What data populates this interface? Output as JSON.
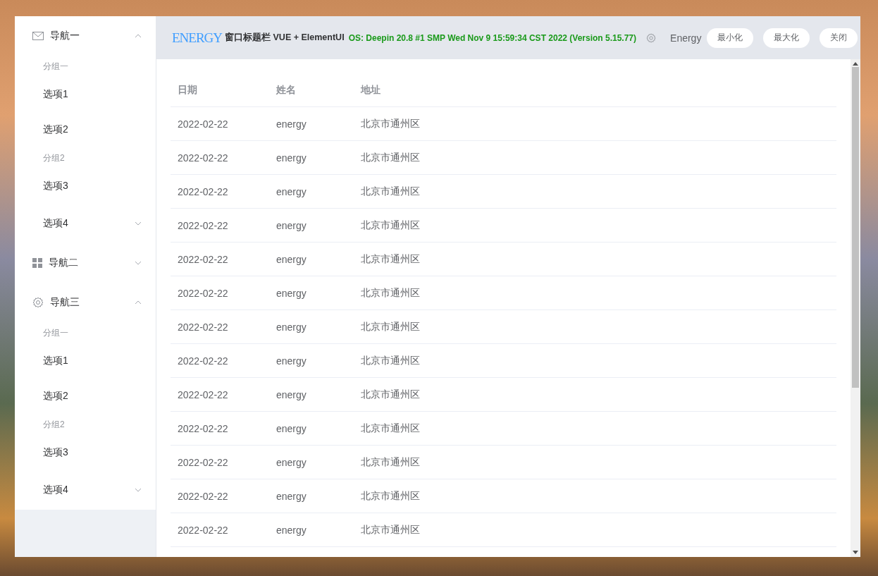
{
  "window": {
    "logo": "ENERGY",
    "title": "窗口标题栏 VUE + ElementUI",
    "os_info": "OS: Deepin 20.8 #1 SMP Wed Nov 9 15:59:34 CST 2022 (Version 5.15.77)",
    "user": "Energy",
    "buttons": [
      "最小化",
      "最大化",
      "关闭"
    ]
  },
  "sidebar": {
    "menus": [
      {
        "title": "导航一",
        "expanded": true,
        "groups": [
          {
            "title": "分组一",
            "items": [
              "选项1",
              "选项2"
            ]
          },
          {
            "title": "分组2",
            "items": [
              "选项3"
            ]
          }
        ],
        "submenus": [
          {
            "title": "选项4",
            "expanded": false
          }
        ]
      },
      {
        "title": "导航二",
        "expanded": false
      },
      {
        "title": "导航三",
        "expanded": true,
        "groups": [
          {
            "title": "分组一",
            "items": [
              "选项1",
              "选项2"
            ]
          },
          {
            "title": "分组2",
            "items": [
              "选项3"
            ]
          }
        ],
        "submenus": [
          {
            "title": "选项4",
            "expanded": false
          }
        ]
      }
    ]
  },
  "table": {
    "columns": [
      "日期",
      "姓名",
      "地址"
    ],
    "rows": [
      [
        "2022-02-22",
        "energy",
        "北京市通州区"
      ],
      [
        "2022-02-22",
        "energy",
        "北京市通州区"
      ],
      [
        "2022-02-22",
        "energy",
        "北京市通州区"
      ],
      [
        "2022-02-22",
        "energy",
        "北京市通州区"
      ],
      [
        "2022-02-22",
        "energy",
        "北京市通州区"
      ],
      [
        "2022-02-22",
        "energy",
        "北京市通州区"
      ],
      [
        "2022-02-22",
        "energy",
        "北京市通州区"
      ],
      [
        "2022-02-22",
        "energy",
        "北京市通州区"
      ],
      [
        "2022-02-22",
        "energy",
        "北京市通州区"
      ],
      [
        "2022-02-22",
        "energy",
        "北京市通州区"
      ],
      [
        "2022-02-22",
        "energy",
        "北京市通州区"
      ],
      [
        "2022-02-22",
        "energy",
        "北京市通州区"
      ],
      [
        "2022-02-22",
        "energy",
        "北京市通州区"
      ]
    ]
  }
}
